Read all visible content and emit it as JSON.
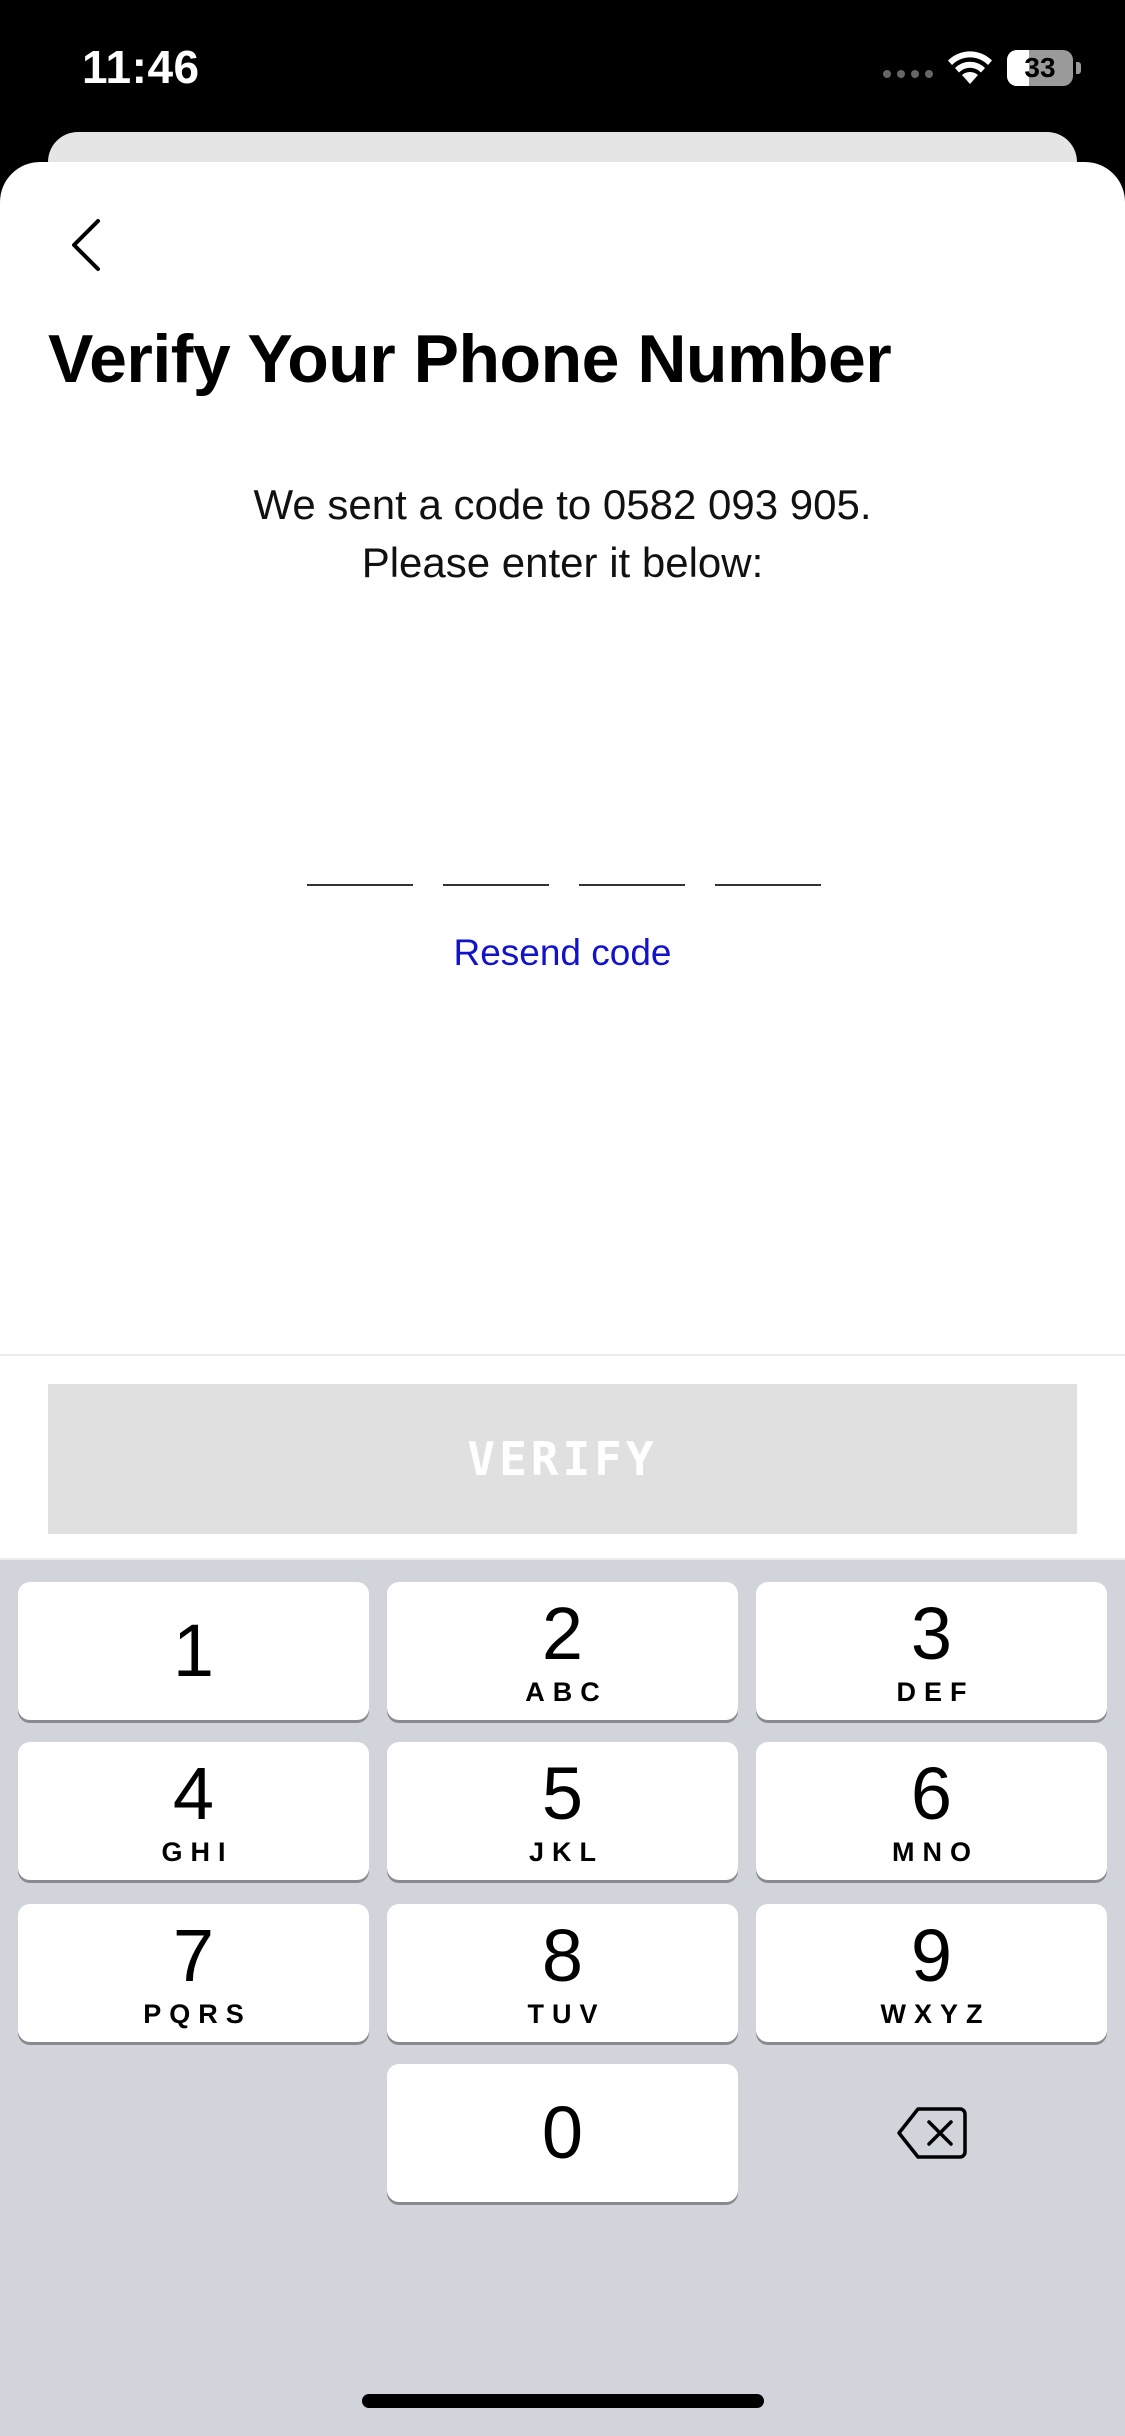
{
  "status_bar": {
    "time": "11:46",
    "battery": "33",
    "battery_level_percent": 33
  },
  "header": {
    "back_icon": "chevron-left-icon",
    "title": "Verify Your Phone Number"
  },
  "instructions": {
    "line1": "We sent a code to 0582 093 905.",
    "line2": "Please enter it below:"
  },
  "code": {
    "slots": [
      "",
      "",
      "",
      ""
    ]
  },
  "resend_label": "Resend code",
  "verify_label": "VERIFY",
  "keyboard": {
    "keys": [
      {
        "digit": "1",
        "letters": ""
      },
      {
        "digit": "2",
        "letters": "ABC"
      },
      {
        "digit": "3",
        "letters": "DEF"
      },
      {
        "digit": "4",
        "letters": "GHI"
      },
      {
        "digit": "5",
        "letters": "JKL"
      },
      {
        "digit": "6",
        "letters": "MNO"
      },
      {
        "digit": "7",
        "letters": "PQRS"
      },
      {
        "digit": "8",
        "letters": "TUV"
      },
      {
        "digit": "9",
        "letters": "WXYZ"
      },
      {
        "digit": "0",
        "letters": ""
      }
    ],
    "delete_icon": "backspace-icon"
  },
  "colors": {
    "link": "#1212c8",
    "verify_disabled": "#e0e0e0",
    "keyboard_bg": "#d1d4db"
  }
}
